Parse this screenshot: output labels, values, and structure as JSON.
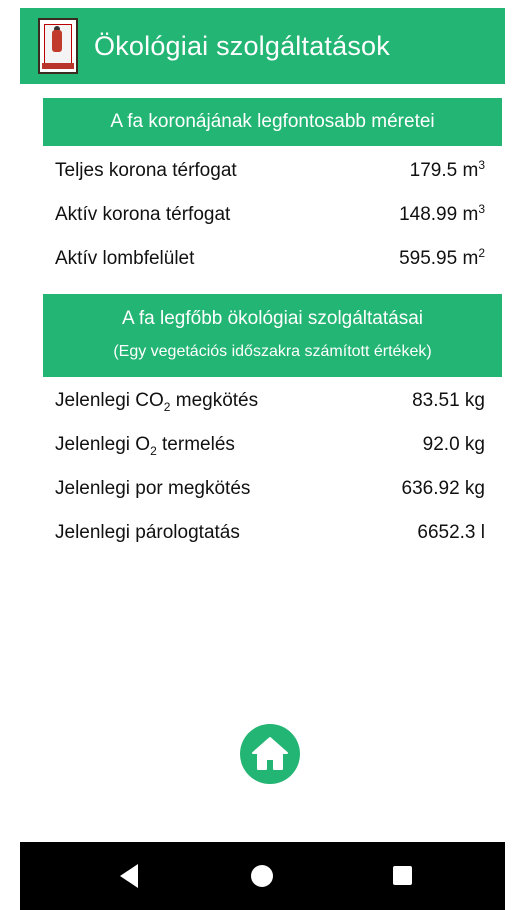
{
  "app": {
    "title": "Ökológiai szolgáltatások"
  },
  "crown": {
    "header": "A fa koronájának legfontosabb méretei",
    "rows": [
      {
        "label": "Teljes korona térfogat",
        "value": "179.5",
        "unit": "m",
        "unit_sup": "3"
      },
      {
        "label": "Aktív korona térfogat",
        "value": "148.99",
        "unit": "m",
        "unit_sup": "3"
      },
      {
        "label": "Aktív lombfelület",
        "value": "595.95",
        "unit": "m",
        "unit_sup": "2"
      }
    ]
  },
  "services": {
    "header": "A fa legfőbb ökológiai szolgáltatásai",
    "subheader": "(Egy vegetációs időszakra számított értékek)",
    "rows": [
      {
        "label_pre": "Jelenlegi CO",
        "label_sub": "2",
        "label_post": " megkötés",
        "value": "83.51 kg"
      },
      {
        "label_pre": "Jelenlegi O",
        "label_sub": "2",
        "label_post": " termelés",
        "value": "92.0 kg"
      },
      {
        "label": "Jelenlegi por megkötés",
        "value": "636.92 kg"
      },
      {
        "label": "Jelenlegi párologtatás",
        "value": "6652.3 l"
      }
    ]
  },
  "icons": {
    "home_button": "home-icon",
    "logo": "app-logo",
    "nav_back": "back-triangle-icon",
    "nav_home": "home-circle-icon",
    "nav_recent": "recent-apps-square-icon"
  },
  "colors": {
    "accent": "#22b573",
    "nav_bar": "#000000"
  }
}
